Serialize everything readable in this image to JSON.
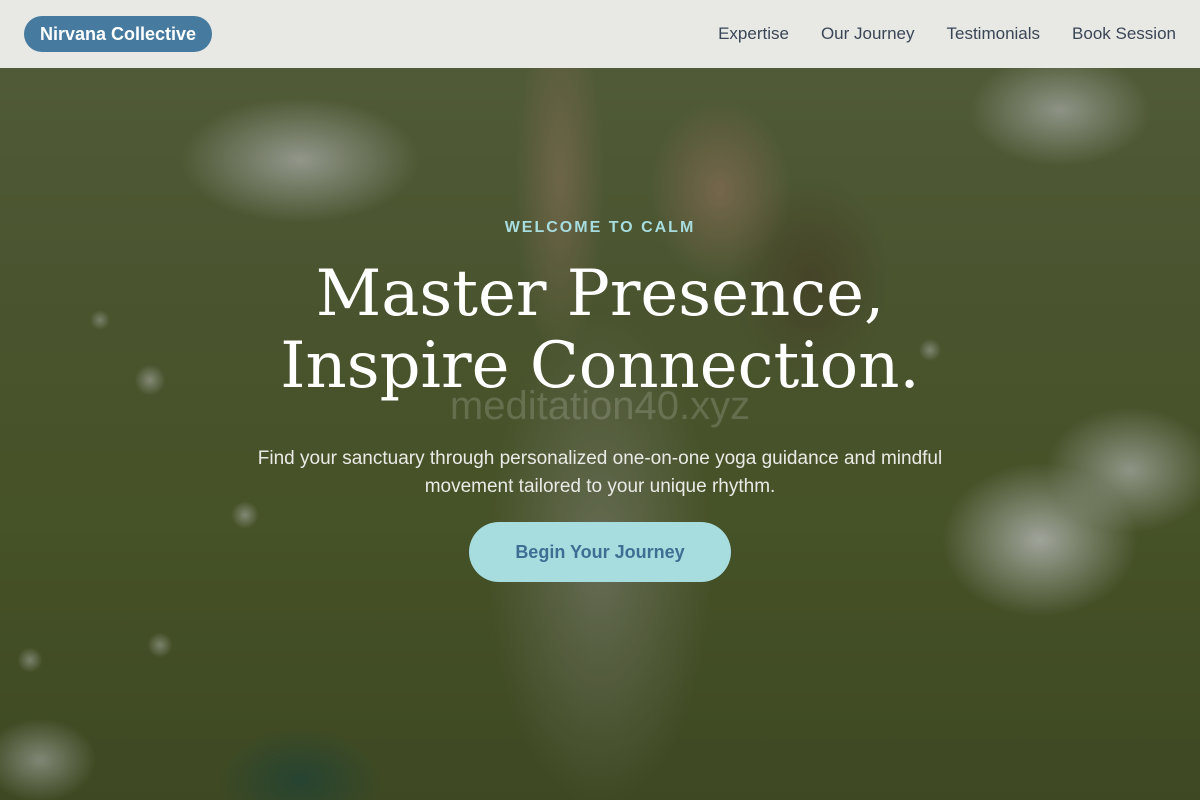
{
  "header": {
    "brand": "Nirvana Collective",
    "nav": [
      {
        "label": "Expertise"
      },
      {
        "label": "Our Journey"
      },
      {
        "label": "Testimonials"
      },
      {
        "label": "Book Session"
      }
    ]
  },
  "hero": {
    "eyebrow": "WELCOME TO CALM",
    "headline_line1": "Master Presence,",
    "headline_line2": "Inspire Connection.",
    "watermark": "meditation40.xyz",
    "subtext": "Find your sanctuary through personalized one-on-one yoga guidance and mindful movement tailored to your unique rhythm.",
    "cta_label": "Begin Your Journey"
  },
  "colors": {
    "brand_bg": "#467a9e",
    "accent": "#a8dde0",
    "cta_text": "#3d6f93",
    "nav_text": "#3a4656"
  }
}
